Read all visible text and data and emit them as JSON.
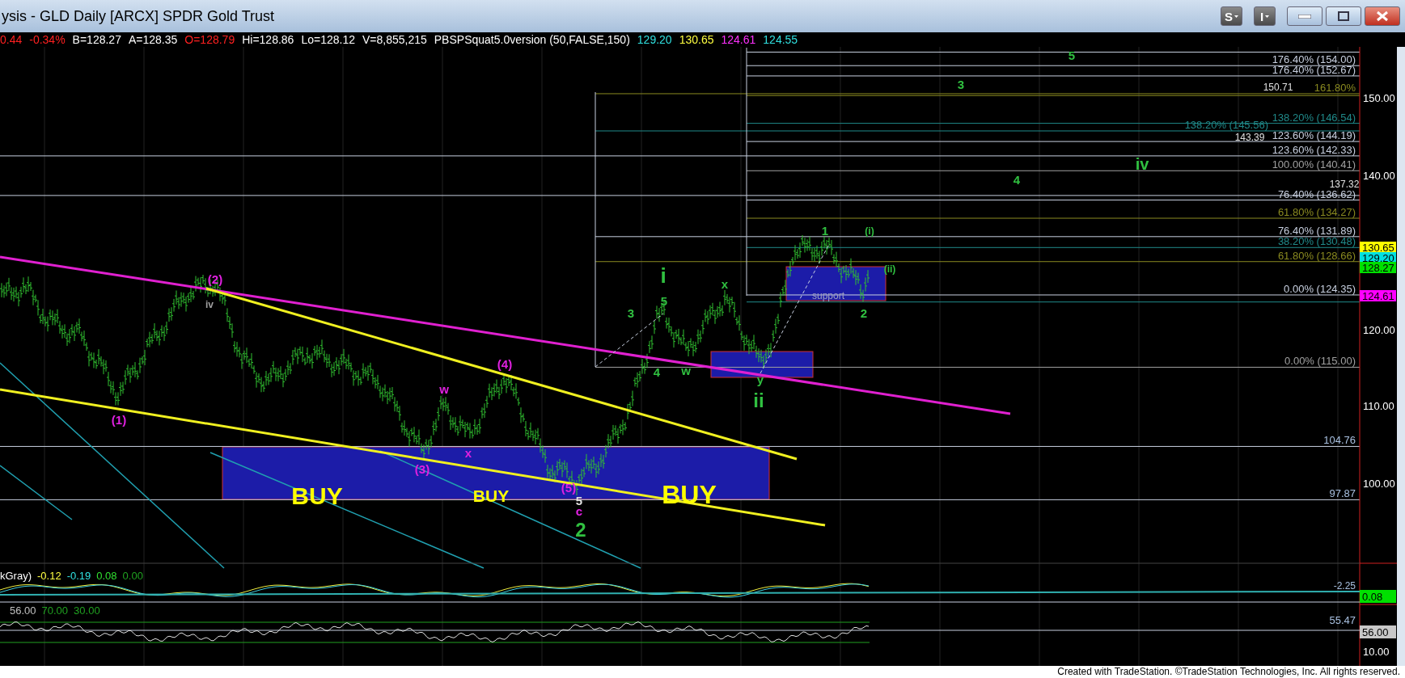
{
  "window": {
    "title": "ysis - GLD Daily [ARCX] SPDR Gold Trust",
    "buttons": [
      {
        "kind": "menu",
        "label": "S"
      },
      {
        "kind": "menu",
        "label": "I"
      },
      {
        "kind": "minimize"
      },
      {
        "kind": "maximize"
      },
      {
        "kind": "close"
      }
    ]
  },
  "quote_bar": [
    {
      "text": "0.44",
      "color": "#ff2020"
    },
    {
      "text": "-0.34%",
      "color": "#ff2020"
    },
    {
      "text": "B=128.27",
      "color": "#ffffff"
    },
    {
      "text": "A=128.35",
      "color": "#ffffff"
    },
    {
      "text": "O=128.79",
      "color": "#ff2020"
    },
    {
      "text": "Hi=128.86",
      "color": "#ffffff"
    },
    {
      "text": "Lo=128.12",
      "color": "#ffffff"
    },
    {
      "text": "V=8,855,215",
      "color": "#ffffff"
    },
    {
      "text": "PBSPSquat5.0version (50,FALSE,150)",
      "color": "#ffffff"
    },
    {
      "text": "129.20",
      "color": "#30e0e0"
    },
    {
      "text": "130.65",
      "color": "#ffff40"
    },
    {
      "text": "124.61",
      "color": "#ff30ff"
    },
    {
      "text": "124.55",
      "color": "#30e0e0"
    }
  ],
  "price_chart": {
    "fib_labels": [
      {
        "text": "176.40% (154.00)",
        "color": "#c8d0e0"
      },
      {
        "text": "176.40% (152.67)",
        "color": "#c8d0e0"
      },
      {
        "text": "161.80%",
        "color": "#8a8a20"
      },
      {
        "text": "138.20% (146.54)",
        "color": "#208a8a"
      },
      {
        "text": "138.20% (145.56)",
        "color": "#208a8a"
      },
      {
        "text": "123.60% (144.19)",
        "color": "#c8d0e0"
      },
      {
        "text": "123.60% (142.33)",
        "color": "#c8d0e0"
      },
      {
        "text": "100.00% (140.41)",
        "color": "#a0a0a0"
      },
      {
        "text": "76.40% (136.62)",
        "color": "#c8d0e0"
      },
      {
        "text": "61.80% (134.27)",
        "color": "#8a8a20"
      },
      {
        "text": "76.40% (131.89)",
        "color": "#c8d0e0"
      },
      {
        "text": "38.20% (130.48)",
        "color": "#208a8a"
      },
      {
        "text": "61.80% (128.66)",
        "color": "#8a8a20"
      },
      {
        "text": "0.00% (124.35)",
        "color": "#c8d0e0"
      },
      {
        "text": "0.00% (115.00)",
        "color": "#a0a0a0"
      },
      {
        "text": "104.76",
        "color": "#a8c0e0"
      },
      {
        "text": "97.87",
        "color": "#a8c0e0"
      }
    ],
    "price_marks": [
      "150.71",
      "143.39",
      "137.32"
    ],
    "wave_labels": [
      {
        "text": "(2)",
        "color": "#e020e0"
      },
      {
        "text": "iv",
        "color": "#a0a0a0"
      },
      {
        "text": "(1)",
        "color": "#e020e0"
      },
      {
        "text": "(3)",
        "color": "#e020e0"
      },
      {
        "text": "w",
        "color": "#e020e0"
      },
      {
        "text": "x",
        "color": "#e020e0"
      },
      {
        "text": "(4)",
        "color": "#e020e0"
      },
      {
        "text": "(5)",
        "color": "#e020e0"
      },
      {
        "text": "5",
        "color": "#e0e0e0"
      },
      {
        "text": "c",
        "color": "#e020e0"
      },
      {
        "text": "2",
        "color": "#30c040"
      },
      {
        "text": "3",
        "color": "#30c040"
      },
      {
        "text": "i",
        "color": "#30c040"
      },
      {
        "text": "5",
        "color": "#30c040"
      },
      {
        "text": "4",
        "color": "#30c040"
      },
      {
        "text": "w",
        "color": "#30c040"
      },
      {
        "text": "x",
        "color": "#30c040"
      },
      {
        "text": "y",
        "color": "#30c040"
      },
      {
        "text": "ii",
        "color": "#30c040"
      },
      {
        "text": "1",
        "color": "#30c040"
      },
      {
        "text": "(i)",
        "color": "#30c040"
      },
      {
        "text": "(ii)",
        "color": "#30c040"
      },
      {
        "text": "2",
        "color": "#30c040"
      },
      {
        "text": "5",
        "color": "#30c040"
      },
      {
        "text": "3",
        "color": "#30c040"
      },
      {
        "text": "4",
        "color": "#30c040"
      },
      {
        "text": "iv",
        "color": "#30c040"
      }
    ],
    "zone_labels": [
      "BUY",
      "BUY",
      "BUY",
      "support"
    ],
    "axis_ticks": [
      "150.00",
      "140.00",
      "120.00",
      "110.00",
      "100.00"
    ],
    "price_badges": [
      {
        "text": "130.65",
        "color": "#ffff00"
      },
      {
        "text": "129.20",
        "color": "#00e0e0"
      },
      {
        "text": "128.27",
        "color": "#00e000"
      },
      {
        "text": "124.61",
        "color": "#ff00ff"
      }
    ]
  },
  "indicator_1": {
    "legend": [
      {
        "text": "kGray)",
        "color": "#ffffff"
      },
      {
        "text": "-0.12",
        "color": "#ffff40"
      },
      {
        "text": "-0.19",
        "color": "#30e0e0"
      },
      {
        "text": "0.08",
        "color": "#30e030"
      },
      {
        "text": "0.00",
        "color": "#20a020"
      }
    ],
    "axis_labels": [
      "-2.25"
    ],
    "badge": "0.08"
  },
  "indicator_2": {
    "legend": [
      {
        "text": "56.00",
        "color": "#c0c0c0"
      },
      {
        "text": "70.00",
        "color": "#20a020"
      },
      {
        "text": "30.00",
        "color": "#20a020"
      }
    ],
    "axis_labels": [
      "55.47",
      "10.00"
    ],
    "badge": "56.00"
  },
  "footer": "Created with TradeStation. ©TradeStation Technologies, Inc. All rights reserved."
}
